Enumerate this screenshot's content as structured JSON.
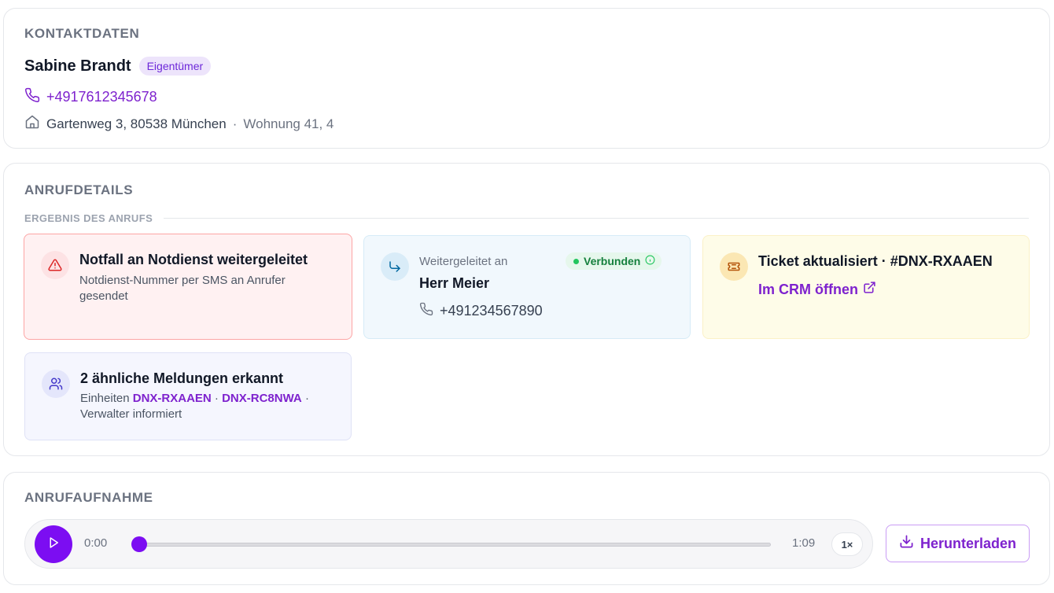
{
  "contact": {
    "section_title": "KONTAKTDATEN",
    "name": "Sabine Brandt",
    "role": "Eigentümer",
    "phone": "+4917612345678",
    "address": "Gartenweg 3, 80538 München",
    "address_separator": "·",
    "unit": "Wohnung 41, 4"
  },
  "call_details": {
    "section_title": "ANRUFDETAILS",
    "result_heading": "ERGEBNIS DES ANRUFS",
    "emergency": {
      "title": "Notfall an Notdienst weitergeleitet",
      "subtitle": "Notdienst-Nummer per SMS an Anrufer gesendet",
      "icon": "warning-triangle-icon"
    },
    "forward": {
      "label": "Weitergeleitet an",
      "name": "Herr Meier",
      "phone": "+491234567890",
      "status": "Verbunden",
      "icon": "forward-arrow-icon"
    },
    "ticket": {
      "title": "Ticket aktualisiert · #DNX-RXAAEN",
      "link": "Im CRM öffnen",
      "icon": "ticket-icon"
    },
    "similar": {
      "title": "2 ähnliche Meldungen erkannt",
      "prefix": "Einheiten",
      "unit_1": "DNX-RXAAEN",
      "separator": "·",
      "unit_2": "DNX-RC8NWA",
      "suffix": "· Verwalter informiert",
      "icon": "users-icon"
    }
  },
  "recording": {
    "section_title": "ANRUFAUFNAHME",
    "current_time": "0:00",
    "duration": "1:09",
    "speed": "1×",
    "progress": 0,
    "download_label": "Herunterladen"
  },
  "colors": {
    "accent": "#7c0df2",
    "link": "#7e22ce",
    "emergency_bg": "#fff1f2",
    "forward_bg": "#f1f8fd",
    "ticket_bg": "#fefce8",
    "similar_bg": "#f5f6fe",
    "success": "#22c55e"
  }
}
